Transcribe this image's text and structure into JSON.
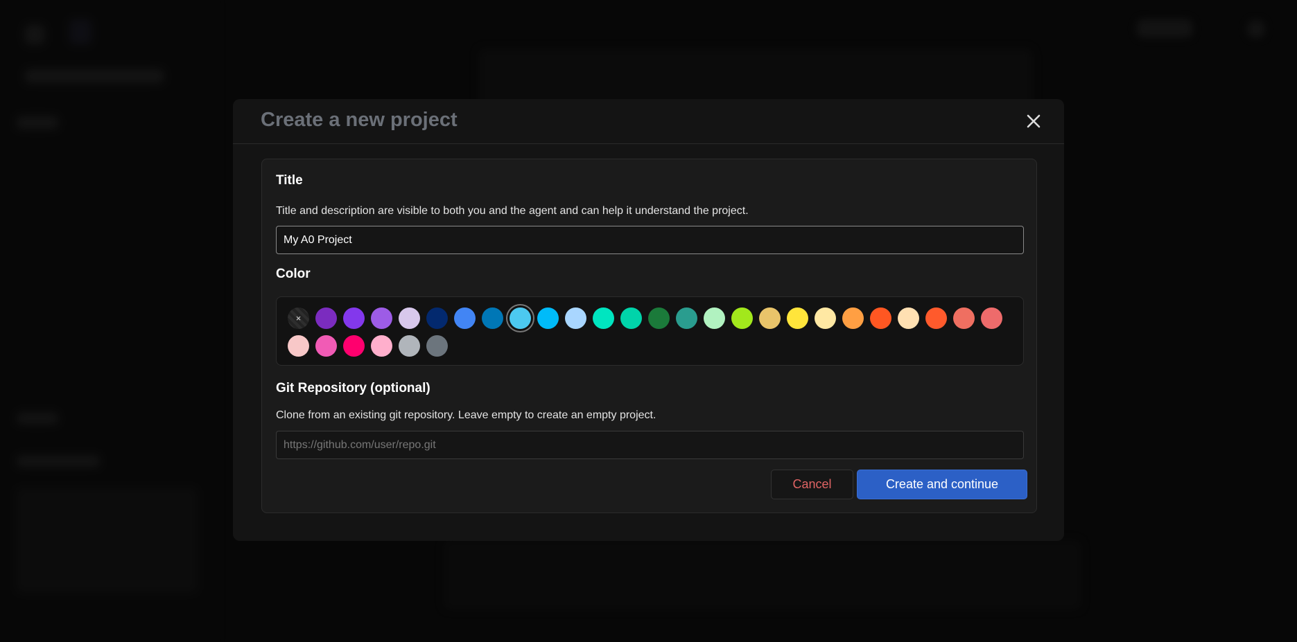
{
  "modal": {
    "title": "Create a new project",
    "title_section": {
      "label": "Title",
      "description": "Title and description are visible to both you and the agent and can help it understand the project.",
      "value": "My A0 Project"
    },
    "color_section": {
      "label": "Color",
      "selected": "#4cc9f0",
      "none_label": "×",
      "colors": [
        "#7b2cbf",
        "#8338ec",
        "#9d5ce6",
        "#d8c8ec",
        "#03296e",
        "#4285f4",
        "#0077b6",
        "#4cc9f0",
        "#00bbf9",
        "#a9d6ff",
        "#00e5c0",
        "#00d4aa",
        "#1b7a3a",
        "#2a9d8f",
        "#b1f2c0",
        "#a2e81c",
        "#e9c46a",
        "#ffe53b",
        "#ffe8a3",
        "#ff9f43",
        "#ff5722",
        "#ffe0b2",
        "#ff5a2c",
        "#ef6f61",
        "#ee6b6b",
        "#f8c8c8",
        "#f15bb5",
        "#ff006e",
        "#ffafcc",
        "#b0b5bb",
        "#6c757d"
      ]
    },
    "git_section": {
      "label": "Git Repository (optional)",
      "description": "Clone from an existing git repository. Leave empty to create an empty project.",
      "placeholder": "https://github.com/user/repo.git",
      "value": ""
    },
    "cancel_label": "Cancel",
    "create_label": "Create and continue"
  }
}
